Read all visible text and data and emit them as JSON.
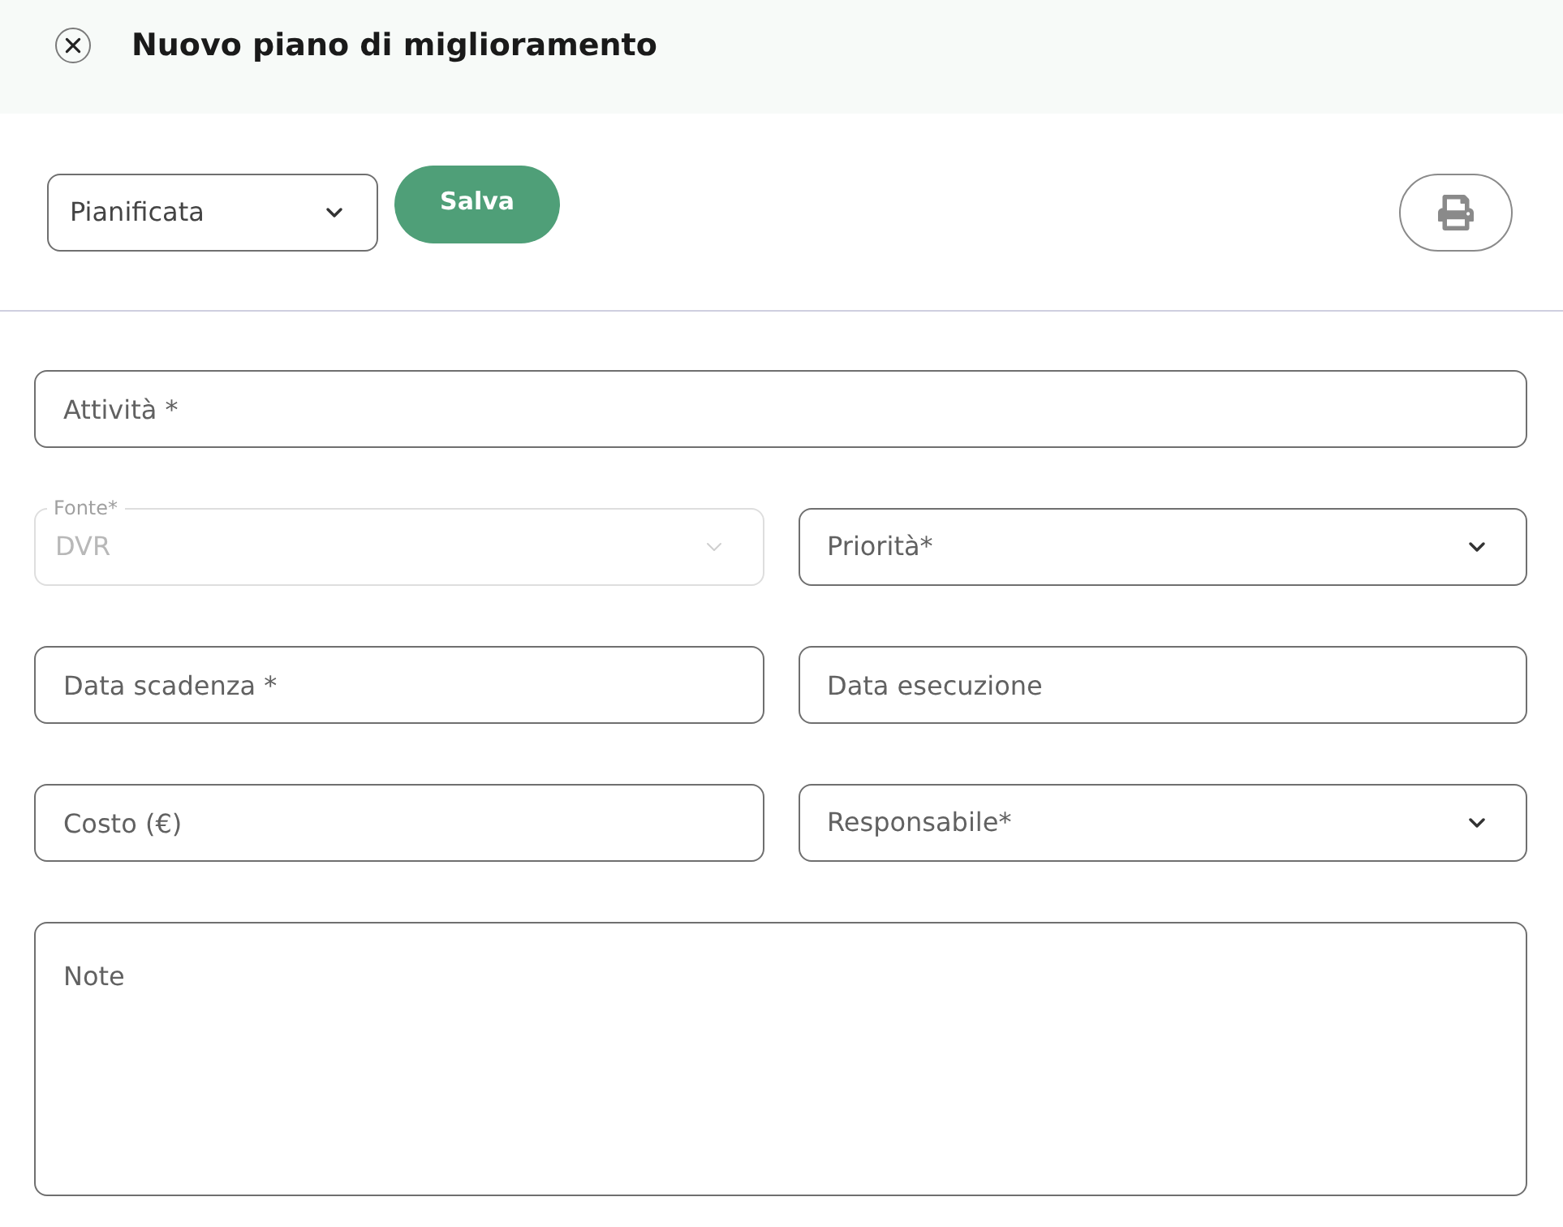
{
  "header": {
    "title": "Nuovo piano di miglioramento"
  },
  "toolbar": {
    "status": {
      "value": "Pianificata"
    },
    "save": {
      "label": "Salva"
    }
  },
  "form": {
    "rows": [
      {
        "fields": [
          {
            "kind": "text",
            "placeholder": "Attività *",
            "disabled": false
          }
        ]
      },
      {
        "fields": [
          {
            "kind": "select",
            "label": "Fonte*",
            "value": "DVR",
            "disabled": true
          },
          {
            "kind": "select",
            "placeholder": "Priorità*",
            "disabled": false
          }
        ]
      },
      {
        "fields": [
          {
            "kind": "text",
            "placeholder": "Data scadenza *",
            "disabled": false
          },
          {
            "kind": "text",
            "placeholder": "Data esecuzione",
            "disabled": false
          }
        ]
      },
      {
        "fields": [
          {
            "kind": "text",
            "placeholder": "Costo (€)",
            "disabled": false
          },
          {
            "kind": "select",
            "placeholder": "Responsabile*",
            "disabled": false
          }
        ]
      },
      {
        "fields": [
          {
            "kind": "textarea",
            "placeholder": "Note",
            "disabled": false
          }
        ]
      }
    ]
  }
}
